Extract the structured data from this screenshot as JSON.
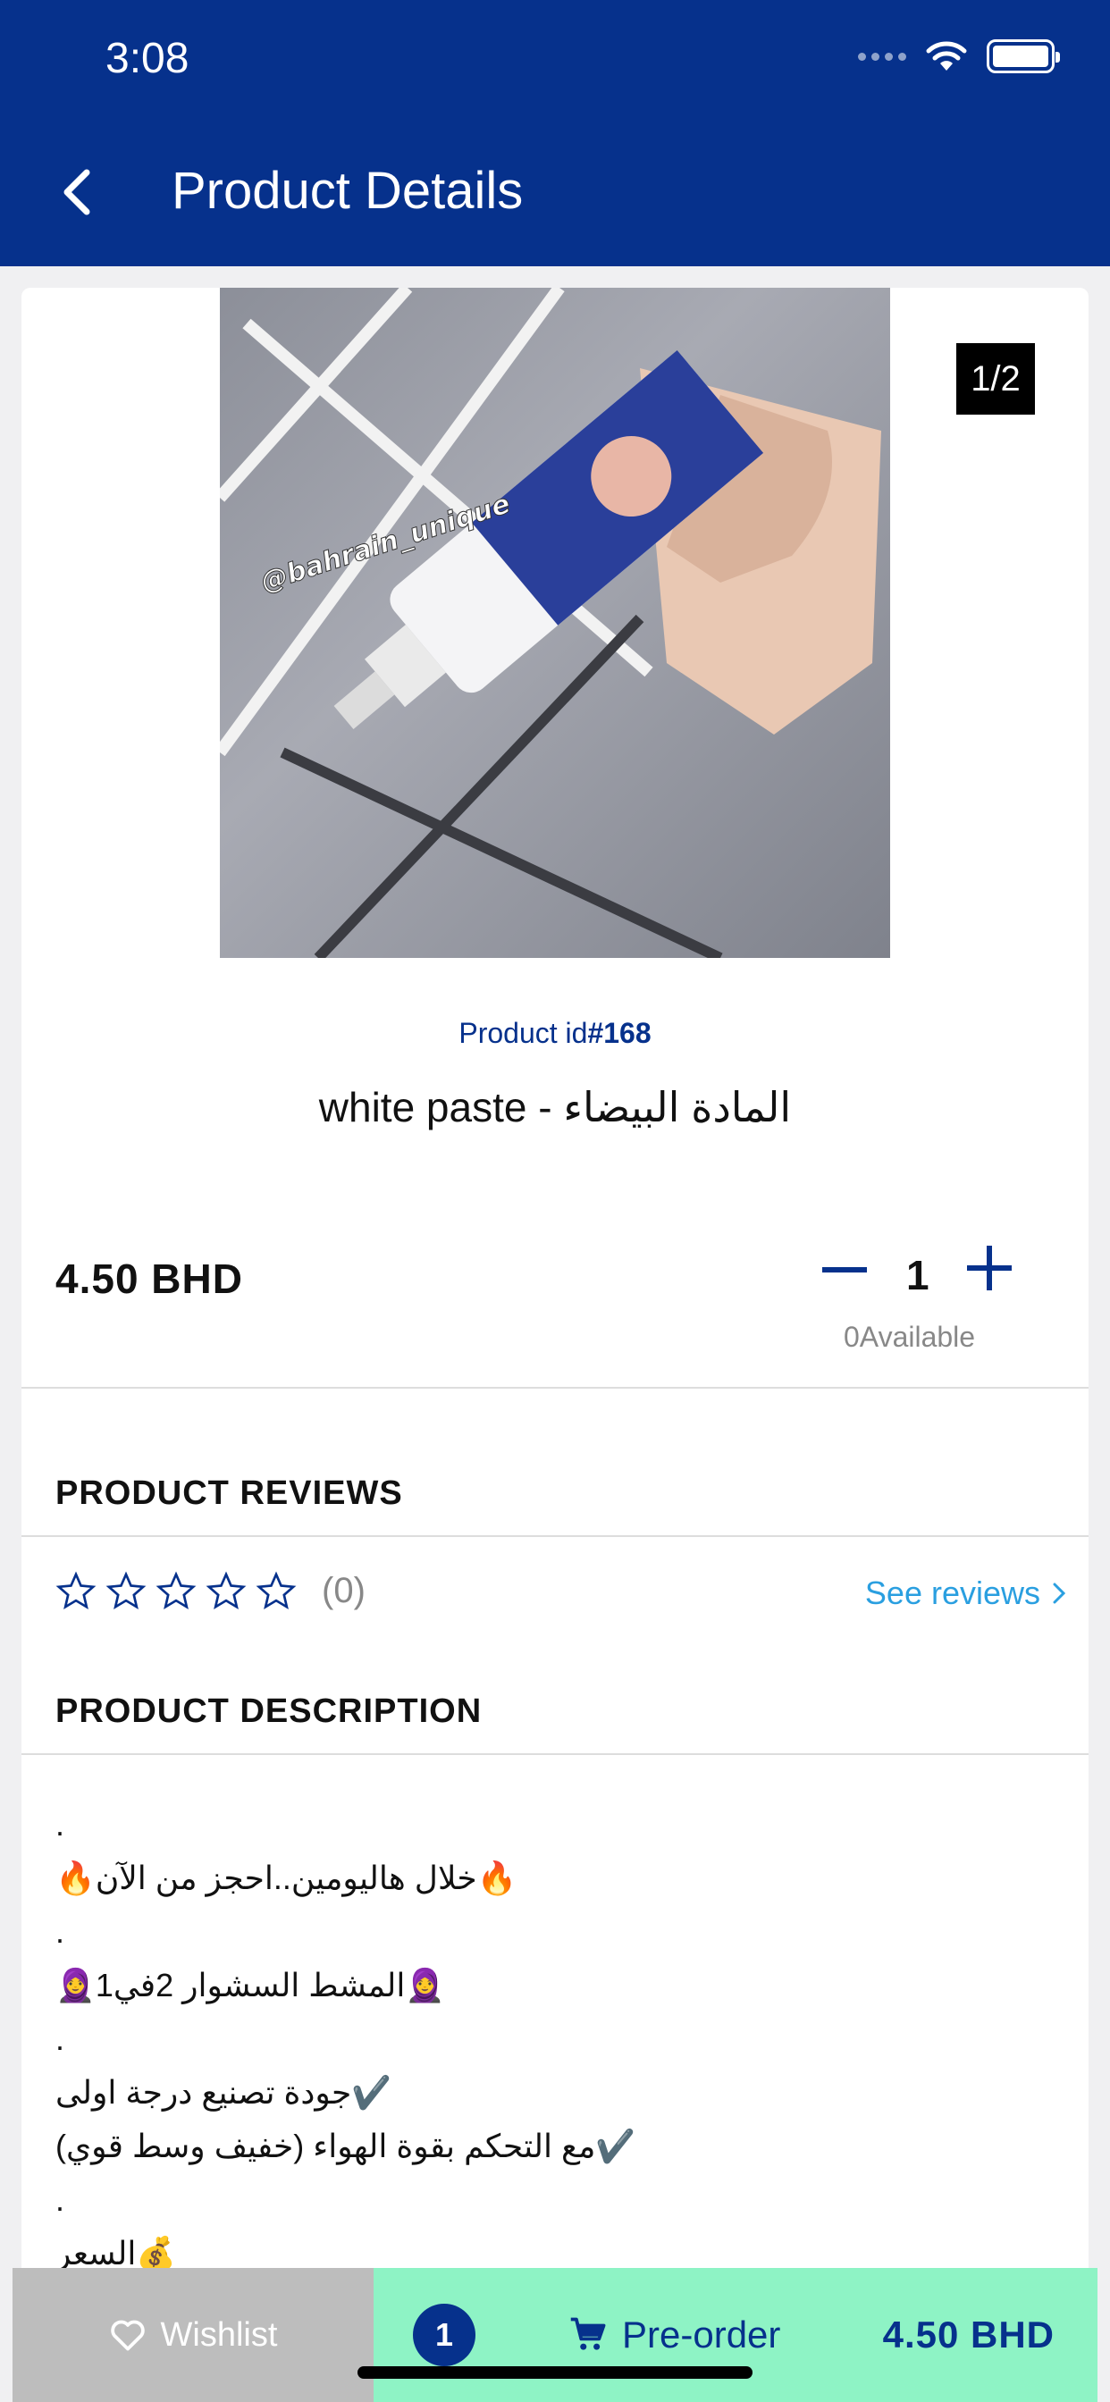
{
  "status_bar": {
    "time": "3:08"
  },
  "header": {
    "title": "Product Details"
  },
  "gallery": {
    "counter": "1/2",
    "watermark": "@bahrain_unique"
  },
  "product": {
    "id_label": "Product id",
    "id_value": "#168",
    "name": "white paste - المادة البيضاء",
    "price": "4.50 BHD",
    "quantity": "1",
    "available": "0Available"
  },
  "reviews": {
    "section_title": "PRODUCT REVIEWS",
    "rating": 0,
    "count": "(0)",
    "see_reviews": "See reviews"
  },
  "description": {
    "section_title": "PRODUCT DESCRIPTION",
    "lines": [
      ".",
      "🔥خلال هاليومين..احجز من الآن🔥",
      ".",
      "🧕المشط السشوار  2في1🧕",
      ".",
      "✔️جودة تصنيع درجة اولى",
      "✔️مع التحكم بقوة الهواء (خفيف وسط قوي)",
      ".",
      "💰السعر"
    ]
  },
  "bottom_bar": {
    "wishlist_label": "Wishlist",
    "cart_count": "1",
    "preorder_label": "Pre-order",
    "price": "4.50 BHD"
  },
  "colors": {
    "primary": "#06318c",
    "accent_green": "#8ef3c5",
    "link_blue": "#2a9fe0",
    "wishlist_gray": "#bdbdbd"
  }
}
